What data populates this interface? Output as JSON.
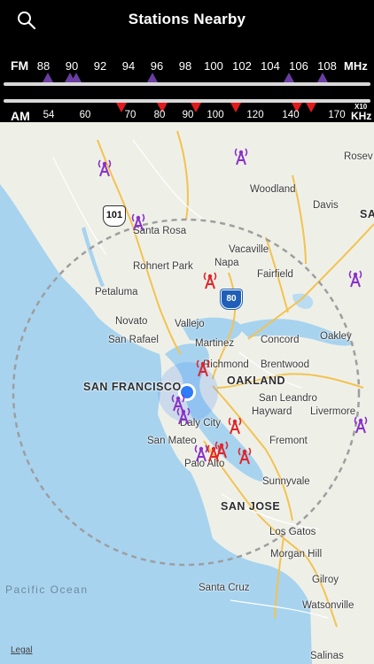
{
  "header": {
    "title": "Stations Nearby"
  },
  "fm": {
    "band": "FM",
    "unit": "MHz",
    "ticks": [
      "88",
      "90",
      "92",
      "94",
      "96",
      "98",
      "100",
      "102",
      "104",
      "106",
      "108"
    ],
    "stations": [
      88.3,
      89.9,
      90.3,
      95.7,
      105.3,
      107.7
    ]
  },
  "am": {
    "band": "AM",
    "unit_exp": "X10",
    "unit": "KHz",
    "ticks": [
      "54",
      "60",
      "70",
      "80",
      "90",
      "100",
      "120",
      "140",
      "170"
    ],
    "stations": [
      68,
      81,
      93,
      110,
      144,
      153
    ]
  },
  "map": {
    "places": {
      "roseville": "Rosev",
      "woodland": "Woodland",
      "davis": "Davis",
      "sa": "SA",
      "santa_rosa": "Santa Rosa",
      "rohnert_park": "Rohnert Park",
      "napa": "Napa",
      "vacaville": "Vacaville",
      "fairfield": "Fairfield",
      "petaluma": "Petaluma",
      "novato": "Novato",
      "vallejo": "Vallejo",
      "san_rafael": "San Rafael",
      "martinez": "Martinez",
      "concord": "Concord",
      "oakley": "Oakley",
      "richmond": "Richmond",
      "brentwood": "Brentwood",
      "san_francisco": "SAN FRANCISCO",
      "oakland": "OAKLAND",
      "san_leandro": "San Leandro",
      "daly_city": "Daly City",
      "hayward": "Hayward",
      "livermore": "Livermore",
      "san_mateo": "San Mateo",
      "fremont": "Fremont",
      "palo_alto": "Palo Alto",
      "sunnyvale": "Sunnyvale",
      "san_jose": "SAN JOSE",
      "los_gatos": "Los Gatos",
      "morgan_hill": "Morgan Hill",
      "gilroy": "Gilroy",
      "santa_cruz": "Santa Cruz",
      "watsonville": "Watsonville",
      "salinas": "Salinas",
      "pacific_ocean": "Pacific Ocean"
    },
    "shields": {
      "us101": "101",
      "i80": "80"
    },
    "legal": "Legal",
    "colors": {
      "fm": "#8b2fc9",
      "am": "#e0242a",
      "water": "#a7d3ef",
      "land": "#eef0e8",
      "location": "#2f7cf6"
    }
  }
}
